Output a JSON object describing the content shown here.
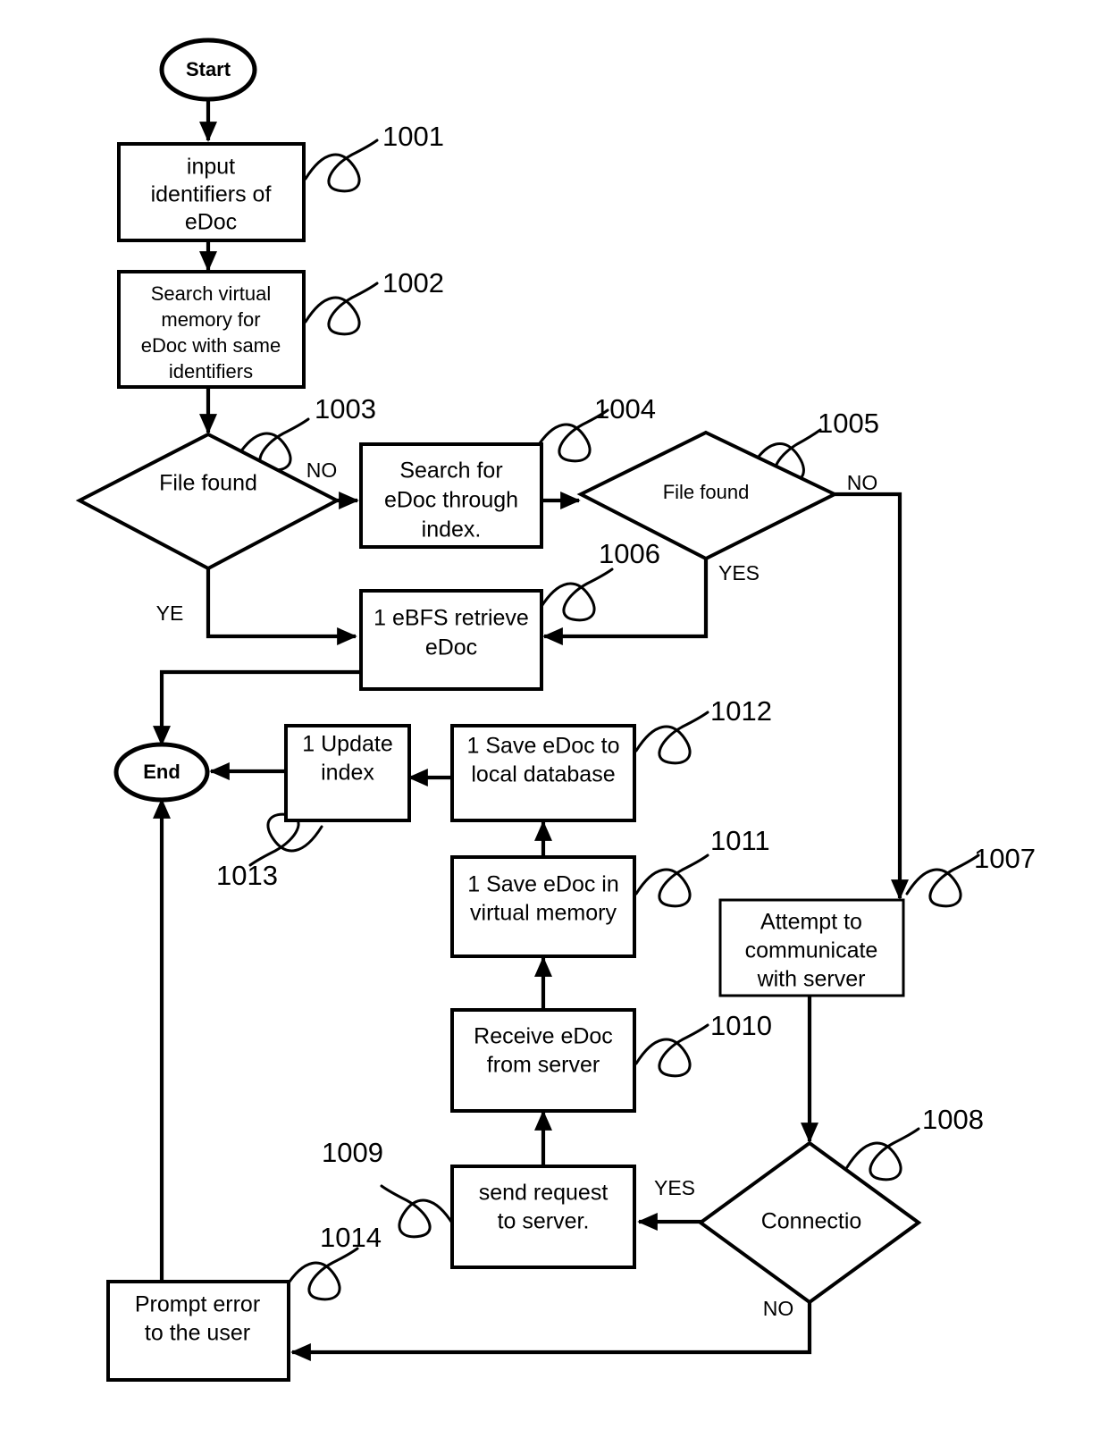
{
  "figure": {
    "type": "flowchart",
    "background": "#ffffff",
    "stroke_color": "#000000"
  },
  "nodes": {
    "start": {
      "label": "Start",
      "shape": "ellipse"
    },
    "n1001": {
      "label_lines": [
        "input",
        "identifiers of",
        "eDoc"
      ],
      "shape": "process"
    },
    "n1002": {
      "label_lines": [
        "Search virtual",
        "memory for",
        "eDoc with same",
        "identifiers"
      ],
      "shape": "process"
    },
    "n1003": {
      "label": "File found",
      "shape": "decision"
    },
    "n1004": {
      "label_lines": [
        "Search for",
        "eDoc through",
        "index."
      ],
      "shape": "process"
    },
    "n1005": {
      "label": "File found",
      "shape": "decision"
    },
    "n1006": {
      "label_lines": [
        "1 eBFS retrieve",
        "eDoc"
      ],
      "shape": "process"
    },
    "n1007": {
      "label_lines": [
        "Attempt to",
        "communicate",
        "with server"
      ],
      "shape": "process"
    },
    "n1008": {
      "label": "Connectio",
      "shape": "decision"
    },
    "n1009": {
      "label_lines": [
        "send request",
        "to server."
      ],
      "shape": "process"
    },
    "n1010": {
      "label_lines": [
        "Receive eDoc",
        "from server"
      ],
      "shape": "process"
    },
    "n1011": {
      "label_lines": [
        "1 Save eDoc in",
        "virtual memory"
      ],
      "shape": "process"
    },
    "n1012": {
      "label_lines": [
        "1 Save eDoc to",
        "local database"
      ],
      "shape": "process"
    },
    "n1013": {
      "label_lines": [
        "1 Update",
        "index"
      ],
      "shape": "process"
    },
    "n1014": {
      "label_lines": [
        "Prompt error",
        "to the user"
      ],
      "shape": "process"
    },
    "end": {
      "label": "End",
      "shape": "ellipse"
    }
  },
  "reference_numerals": {
    "r1001": "1001",
    "r1002": "1002",
    "r1003": "1003",
    "r1004": "1004",
    "r1005": "1005",
    "r1006": "1006",
    "r1007": "1007",
    "r1008": "1008",
    "r1009": "1009",
    "r1010": "1010",
    "r1011": "1011",
    "r1012": "1012",
    "r1013": "1013",
    "r1014": "1014"
  },
  "edge_labels": {
    "no_1003": "NO",
    "ye_1003": "YE",
    "no_1005": "NO",
    "yes_1005": "YES",
    "yes_1008": "YES",
    "no_1008": "NO"
  }
}
